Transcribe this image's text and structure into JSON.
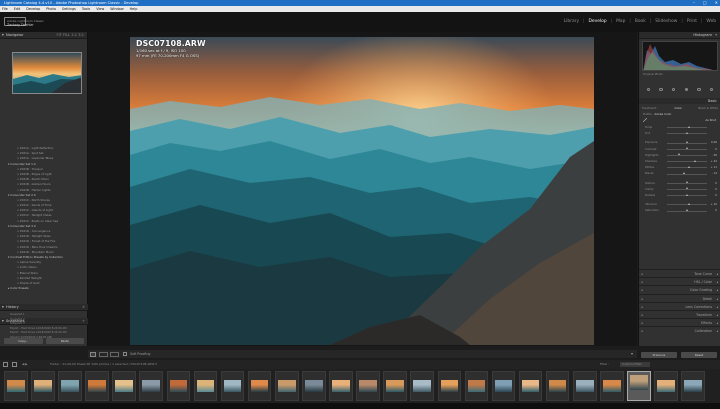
{
  "window": {
    "title": "Lightroom Catalog 4-4-v10 - Adobe Photoshop Lightroom Classic - Develop",
    "controls": [
      "–",
      "□",
      "✕"
    ]
  },
  "menu": [
    "File",
    "Edit",
    "Develop",
    "Photo",
    "Settings",
    "Tools",
    "View",
    "Window",
    "Help"
  ],
  "identity": {
    "line1": "Adobe Lightroom Classic",
    "line2": "Zachary Doehler"
  },
  "modules": [
    {
      "label": "Library",
      "active": false
    },
    {
      "label": "Develop",
      "active": true
    },
    {
      "label": "Map",
      "active": false
    },
    {
      "label": "Book",
      "active": false
    },
    {
      "label": "Slideshow",
      "active": false
    },
    {
      "label": "Print",
      "active": false
    },
    {
      "label": "Web",
      "active": false
    }
  ],
  "left_panel": {
    "navigator": {
      "label": "Navigator",
      "zoom": "FIT  FILL  1:1  3:1"
    },
    "collections": [
      {
        "label": "2021A - Light Reflection",
        "kind": "sub"
      },
      {
        "label": "2021A - Spot Set",
        "kind": "sub"
      },
      {
        "label": "2021A - Lavender Blues",
        "kind": "sub"
      },
      {
        "label": "Colourstar Set 1.0",
        "kind": "set"
      },
      {
        "label": "2021B - Tranquil",
        "kind": "sub"
      },
      {
        "label": "2021B - Edges of Light",
        "kind": "sub"
      },
      {
        "label": "2021B - Pacific Moon",
        "kind": "sub"
      },
      {
        "label": "2021B - Golden Hours",
        "kind": "sub"
      },
      {
        "label": "2021B - Harbor Lights",
        "kind": "sub"
      },
      {
        "label": "Colourstar Set 2.0",
        "kind": "set"
      },
      {
        "label": "2021C - North Shores",
        "kind": "sub"
      },
      {
        "label": "2021C - Sands of Time",
        "kind": "sub"
      },
      {
        "label": "2021C - Islands of Light",
        "kind": "sub"
      },
      {
        "label": "2021C - Twilight Vistas",
        "kind": "sub"
      },
      {
        "label": "2021C - Boats on Clear Sea",
        "kind": "sub"
      },
      {
        "label": "Colourstar Set 3.0",
        "kind": "set"
      },
      {
        "label": "2021D - Convergence",
        "kind": "sub"
      },
      {
        "label": "2021D - Twilight Skies",
        "kind": "sub"
      },
      {
        "label": "2021D - Forest of the Fire",
        "kind": "sub"
      },
      {
        "label": "2021D - Blue Hour Dreams",
        "kind": "sub"
      },
      {
        "label": "2021D - Mountain Mood",
        "kind": "sub"
      },
      {
        "label": "Contrast Edition Presets by Collection",
        "kind": "set"
      },
      {
        "label": "Alpine Serenity",
        "kind": "sub"
      },
      {
        "label": "Arctic Dawn",
        "kind": "sub"
      },
      {
        "label": "Eternal Stars",
        "kind": "sub"
      },
      {
        "label": "Painted Twilight",
        "kind": "sub"
      },
      {
        "label": "Shade of Gold",
        "kind": "sub"
      },
      {
        "label": "Color Presets",
        "kind": "set-open"
      }
    ],
    "snapshots_label": "Snapshots",
    "history_label": "History",
    "history": [
      "Snapshot 1",
      "Snapshot 2",
      "Snapshot 3",
      "Export - Hard Drive 12/18/2020 8:24:00 AM",
      "Export - Hard Drive 12/18/2020 8:22:00 AM",
      "Import (12/18/2020 7:48:00 AM)"
    ],
    "copy_label": "Copy...",
    "paste_label": "Paste"
  },
  "photo": {
    "filename": "DSC07108.ARW",
    "exposure": "1/160 sec at f / 9, ISO 100",
    "lens": "97 mm (FE 70-200mm F4 G OSS)"
  },
  "toolbar": {
    "softproof_label": "Soft Proofing"
  },
  "right_panel": {
    "histogram_label": "Histogram",
    "original_photo": "Original Photo",
    "basic_label": "Basic",
    "treatment": [
      "Treatment :",
      "Color",
      "Black & White"
    ],
    "profile": "Adobe Color",
    "wb": "As Shot",
    "sliders": [
      {
        "label": "Temp",
        "value": "",
        "pos": 0.55
      },
      {
        "label": "Tint",
        "value": "",
        "pos": 0.5
      },
      {
        "label": "Exposure",
        "value": "0.00",
        "pos": 0.5
      },
      {
        "label": "Contrast",
        "value": "0",
        "pos": 0.5
      },
      {
        "label": "Highlights",
        "value": "- 36",
        "pos": 0.32
      },
      {
        "label": "Shadows",
        "value": "+ 44",
        "pos": 0.72
      },
      {
        "label": "Whites",
        "value": "+ 11",
        "pos": 0.56
      },
      {
        "label": "Blacks",
        "value": "- 14",
        "pos": 0.43
      },
      {
        "label": "Texture",
        "value": "0",
        "pos": 0.5
      },
      {
        "label": "Clarity",
        "value": "0",
        "pos": 0.5
      },
      {
        "label": "Dehaze",
        "value": "0",
        "pos": 0.5
      },
      {
        "label": "Vibrance",
        "value": "+ 10",
        "pos": 0.55
      },
      {
        "label": "Saturation",
        "value": "0",
        "pos": 0.5
      }
    ],
    "panels": [
      "Tone Curve",
      "HSL / Color",
      "Color Grading",
      "Detail",
      "Lens Corrections",
      "Transform",
      "Effects",
      "Calibration"
    ]
  },
  "right_buttons": {
    "previous": "Previous",
    "reset": "Reset"
  },
  "filmstrip": {
    "info": "Folder : 21-09-09 Sheet-SE   1/60 photos / 1 selected / DSC07108.ARW ▾",
    "filter": "Filter :",
    "filter_value": "Custom Filter"
  },
  "colors": {
    "accent": "#1f6fc5",
    "panel": "#313131",
    "bg": "#161616"
  }
}
